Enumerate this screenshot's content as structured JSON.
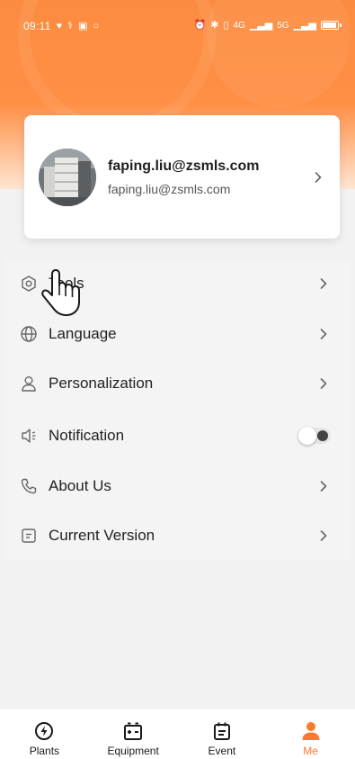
{
  "status_bar": {
    "time": "09:11",
    "network": "4G",
    "network2": "5G"
  },
  "profile": {
    "name": "faping.liu@zsmls.com",
    "email": "faping.liu@zsmls.com"
  },
  "menu": {
    "items": [
      {
        "label": "Tools",
        "icon": "hexagon-settings-icon"
      },
      {
        "label": "Language",
        "icon": "globe-icon"
      },
      {
        "label": "Personalization",
        "icon": "person-icon"
      },
      {
        "label": "Notification",
        "icon": "speaker-icon"
      },
      {
        "label": "About Us",
        "icon": "phone-icon"
      },
      {
        "label": "Current Version",
        "icon": "document-icon"
      }
    ],
    "notification_enabled": false
  },
  "tabbar": {
    "items": [
      {
        "label": "Plants",
        "icon": "plant-power-icon"
      },
      {
        "label": "Equipment",
        "icon": "battery-equipment-icon"
      },
      {
        "label": "Event",
        "icon": "calendar-event-icon"
      },
      {
        "label": "Me",
        "icon": "person-filled-icon"
      }
    ],
    "active": "Me"
  },
  "colors": {
    "accent": "#ff7a2e",
    "header_top": "#fb8c3f",
    "background": "#f2f2f2"
  }
}
